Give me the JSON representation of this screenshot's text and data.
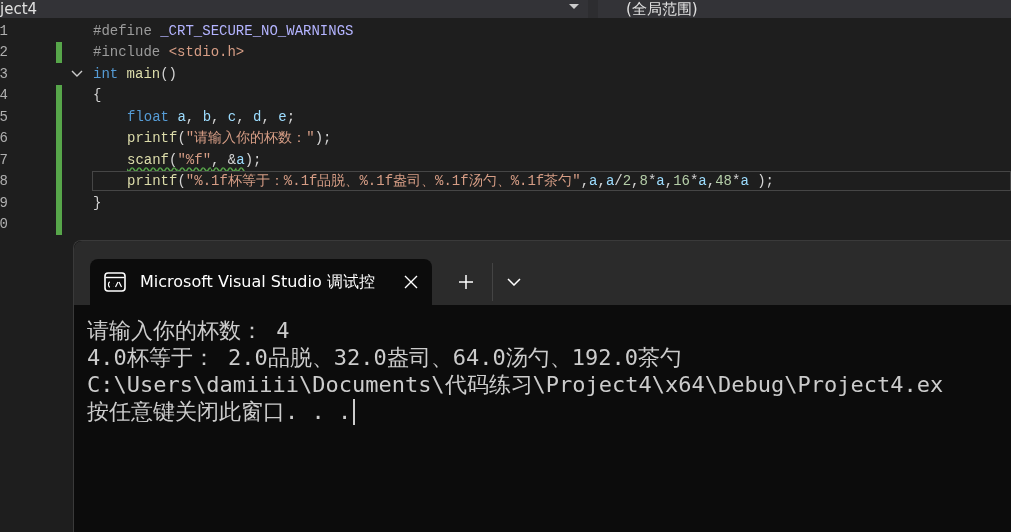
{
  "toolbar": {
    "project": "ject4",
    "scope": "(全局范围)"
  },
  "editor": {
    "lines": [
      {
        "number": "1",
        "changed": false,
        "fold": false,
        "current": false,
        "indented": false,
        "tokens": [
          {
            "kind": "directive",
            "text": "#define "
          },
          {
            "kind": "macro",
            "text": "_CRT_SECURE_NO_WARNINGS"
          }
        ]
      },
      {
        "number": "2",
        "changed": true,
        "fold": false,
        "current": false,
        "indented": false,
        "tokens": [
          {
            "kind": "directive",
            "text": "#include "
          },
          {
            "kind": "string",
            "text": "<stdio.h>"
          }
        ]
      },
      {
        "number": "3",
        "changed": false,
        "fold": true,
        "current": false,
        "indented": false,
        "tokens": [
          {
            "kind": "keyword",
            "text": "int "
          },
          {
            "kind": "function",
            "text": "main"
          },
          {
            "kind": "punct",
            "text": "()"
          }
        ]
      },
      {
        "number": "4",
        "changed": true,
        "fold": false,
        "current": false,
        "indented": false,
        "tokens": [
          {
            "kind": "punct",
            "text": "{"
          }
        ]
      },
      {
        "number": "5",
        "changed": true,
        "fold": false,
        "current": false,
        "indented": true,
        "tokens": [
          {
            "kind": "keyword",
            "text": "float "
          },
          {
            "kind": "variable",
            "text": "a"
          },
          {
            "kind": "punct",
            "text": ", "
          },
          {
            "kind": "variable",
            "text": "b"
          },
          {
            "kind": "punct",
            "text": ", "
          },
          {
            "kind": "variable",
            "text": "c"
          },
          {
            "kind": "punct",
            "text": ", "
          },
          {
            "kind": "variable",
            "text": "d"
          },
          {
            "kind": "punct",
            "text": ", "
          },
          {
            "kind": "variable",
            "text": "e"
          },
          {
            "kind": "punct",
            "text": ";"
          }
        ]
      },
      {
        "number": "6",
        "changed": true,
        "fold": false,
        "current": false,
        "indented": true,
        "tokens": [
          {
            "kind": "function",
            "text": "printf"
          },
          {
            "kind": "punct",
            "text": "("
          },
          {
            "kind": "string",
            "text": "\"请输入你的杯数：\""
          },
          {
            "kind": "punct",
            "text": ");"
          }
        ]
      },
      {
        "number": "7",
        "changed": true,
        "fold": false,
        "current": false,
        "indented": true,
        "tokens": [
          {
            "kind": "function",
            "text": "scanf",
            "squiggle": true
          },
          {
            "kind": "punct",
            "text": "(",
            "squiggle": true
          },
          {
            "kind": "string",
            "text": "\"%f\"",
            "squiggle": true
          },
          {
            "kind": "punct",
            "text": ", &",
            "squiggle": true
          },
          {
            "kind": "variable",
            "text": "a",
            "squiggle": true
          },
          {
            "kind": "punct",
            "text": ");"
          }
        ]
      },
      {
        "number": "8",
        "changed": true,
        "fold": false,
        "current": true,
        "indented": true,
        "tokens": [
          {
            "kind": "function",
            "text": "printf"
          },
          {
            "kind": "punct",
            "text": "("
          },
          {
            "kind": "string",
            "text": "\"%.1f杯等于：%.1f品脱、%.1f盎司、%.1f汤勺、%.1f茶勺\""
          },
          {
            "kind": "punct",
            "text": ","
          },
          {
            "kind": "variable",
            "text": "a"
          },
          {
            "kind": "punct",
            "text": ","
          },
          {
            "kind": "variable",
            "text": "a"
          },
          {
            "kind": "punct",
            "text": "/"
          },
          {
            "kind": "number",
            "text": "2"
          },
          {
            "kind": "punct",
            "text": ","
          },
          {
            "kind": "number",
            "text": "8"
          },
          {
            "kind": "punct",
            "text": "*"
          },
          {
            "kind": "variable",
            "text": "a"
          },
          {
            "kind": "punct",
            "text": ","
          },
          {
            "kind": "number",
            "text": "16"
          },
          {
            "kind": "punct",
            "text": "*"
          },
          {
            "kind": "variable",
            "text": "a"
          },
          {
            "kind": "punct",
            "text": ","
          },
          {
            "kind": "number",
            "text": "48"
          },
          {
            "kind": "punct",
            "text": "*"
          },
          {
            "kind": "variable",
            "text": "a"
          },
          {
            "kind": "punct",
            "text": " );"
          }
        ]
      },
      {
        "number": "9",
        "changed": true,
        "fold": false,
        "current": false,
        "indented": false,
        "tokens": [
          {
            "kind": "punct",
            "text": "}"
          }
        ]
      },
      {
        "number": "0",
        "changed": true,
        "fold": false,
        "current": false
      }
    ]
  },
  "terminal": {
    "tab": {
      "title": "Microsoft Visual Studio 调试控",
      "selected": true
    },
    "output": [
      {
        "text": "请输入你的杯数： 4",
        "cursor": false
      },
      {
        "text": "4.0杯等于： 2.0品脱、32.0盎司、64.0汤勺、192.0茶勺",
        "cursor": false
      },
      {
        "text": "C:\\Users\\damiiii\\Documents\\代码练习\\Project4\\x64\\Debug\\Project4.ex",
        "cursor": false
      },
      {
        "text": "按任意键关闭此窗口. . .",
        "cursor": true
      }
    ]
  }
}
